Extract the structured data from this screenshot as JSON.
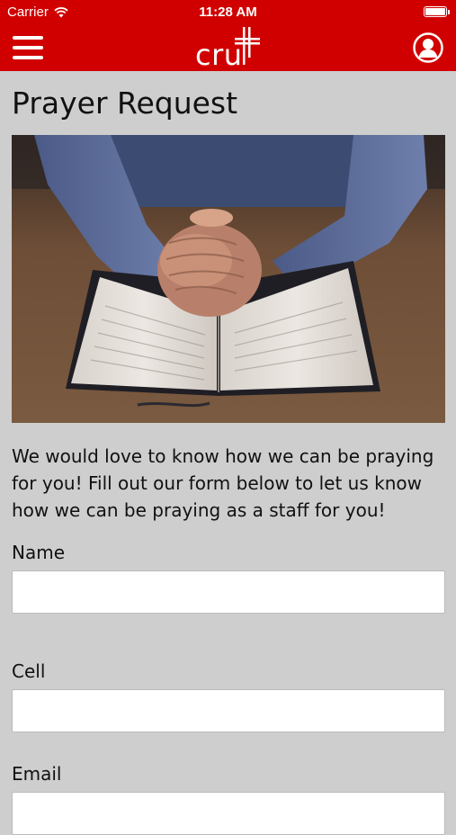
{
  "status_bar": {
    "carrier": "Carrier",
    "time": "11:28 AM"
  },
  "nav": {
    "logo_text": "cru"
  },
  "page": {
    "title": "Prayer Request",
    "intro": "We would love to know how we can be praying for you!  Fill out our form below to let us know how we can be praying as a staff for you!"
  },
  "form": {
    "name_label": "Name",
    "name_value": "",
    "cell_label": "Cell",
    "cell_value": "",
    "email_label": "Email",
    "email_value": ""
  },
  "colors": {
    "brand_red": "#d10000",
    "background": "#cecece"
  },
  "icons": {
    "menu": "hamburger-menu-icon",
    "profile": "user-profile-icon",
    "wifi": "wifi-icon",
    "battery": "battery-icon"
  }
}
